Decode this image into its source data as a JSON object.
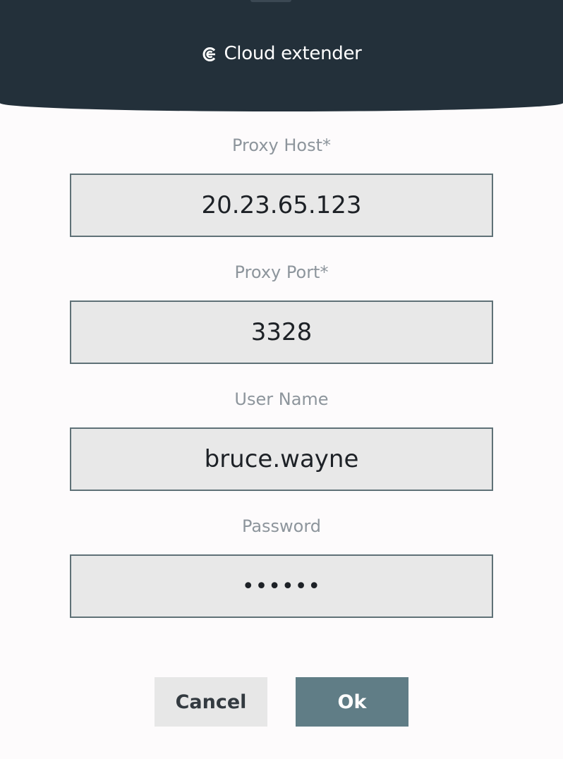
{
  "header": {
    "title": "Cloud extender",
    "icon": "cloud-extender-logo-icon",
    "background_color": "#23303a"
  },
  "form": {
    "proxy_host": {
      "label": "Proxy Host*",
      "value": "20.23.65.123"
    },
    "proxy_port": {
      "label": "Proxy Port*",
      "value": "3328"
    },
    "user_name": {
      "label": "User Name",
      "value": "bruce.wayne"
    },
    "password": {
      "label": "Password",
      "value": "••••••"
    }
  },
  "actions": {
    "cancel_label": "Cancel",
    "ok_label": "Ok",
    "ok_color": "#607d86"
  }
}
